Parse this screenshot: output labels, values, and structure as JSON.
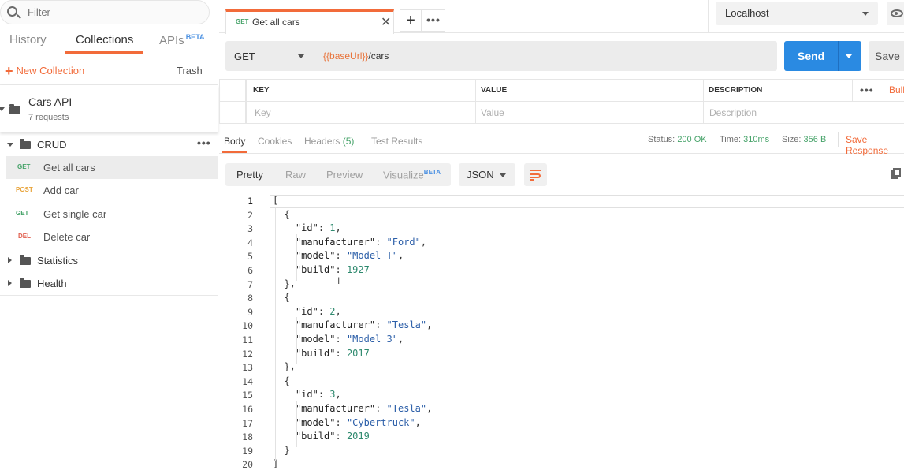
{
  "sidebar": {
    "filter_placeholder": "Filter",
    "tabs": [
      {
        "label": "History"
      },
      {
        "label": "Collections"
      },
      {
        "label": "APIs",
        "badge": "BETA"
      }
    ],
    "new_collection_label": "New Collection",
    "trash_label": "Trash",
    "collection": {
      "name": "Cars API",
      "count": "7 requests"
    },
    "folders": [
      {
        "name": "CRUD",
        "expanded": true
      },
      {
        "name": "Statistics",
        "expanded": false
      },
      {
        "name": "Health",
        "expanded": false
      }
    ],
    "requests": [
      {
        "method": "GET",
        "name": "Get all cars",
        "selected": true
      },
      {
        "method": "POST",
        "name": "Add car"
      },
      {
        "method": "GET",
        "name": "Get single car"
      },
      {
        "method": "DEL",
        "name": "Delete car"
      }
    ]
  },
  "tab": {
    "method": "GET",
    "name": "Get all cars"
  },
  "environment": {
    "selected": "Localhost"
  },
  "request": {
    "method": "GET",
    "url_variable": "{{baseUrl}}",
    "url_path": "/cars",
    "send_label": "Send",
    "save_label": "Save"
  },
  "params": {
    "headers": [
      "KEY",
      "VALUE",
      "DESCRIPTION"
    ],
    "bulk_label": "Bulk",
    "placeholders": [
      "Key",
      "Value",
      "Description"
    ]
  },
  "response": {
    "tabs": [
      {
        "label": "Body"
      },
      {
        "label": "Cookies"
      },
      {
        "label": "Headers",
        "count": "(5)"
      },
      {
        "label": "Test Results"
      }
    ],
    "status_label": "Status:",
    "status_value": "200 OK",
    "time_label": "Time:",
    "time_value": "310ms",
    "size_label": "Size:",
    "size_value": "356 B",
    "save_response_label": "Save Response",
    "formats": [
      "Pretty",
      "Raw",
      "Preview",
      "Visualize"
    ],
    "visualize_badge": "BETA",
    "language": "JSON",
    "lines": [
      [
        "[",
        ""
      ],
      [
        "  {",
        ""
      ],
      [
        "    ",
        "\"id\": 1,"
      ],
      [
        "    ",
        "\"manufacturer\": \"Ford\","
      ],
      [
        "    ",
        "\"model\": \"Model T\","
      ],
      [
        "    ",
        "\"build\": 1927"
      ],
      [
        "  },",
        ""
      ],
      [
        "  {",
        ""
      ],
      [
        "    ",
        "\"id\": 2,"
      ],
      [
        "    ",
        "\"manufacturer\": \"Tesla\","
      ],
      [
        "    ",
        "\"model\": \"Model 3\","
      ],
      [
        "    ",
        "\"build\": 2017"
      ],
      [
        "  },",
        ""
      ],
      [
        "  {",
        ""
      ],
      [
        "    ",
        "\"id\": 3,"
      ],
      [
        "    ",
        "\"manufacturer\": \"Tesla\","
      ],
      [
        "    ",
        "\"model\": \"Cybertruck\","
      ],
      [
        "    ",
        "\"build\": 2019"
      ],
      [
        "  }",
        ""
      ],
      [
        "]",
        ""
      ]
    ]
  },
  "colors": {
    "accent": "#f26b3a",
    "send": "#2a8ae2",
    "get": "#47a36a",
    "post": "#e8a33a",
    "delete": "#e05c4b"
  }
}
